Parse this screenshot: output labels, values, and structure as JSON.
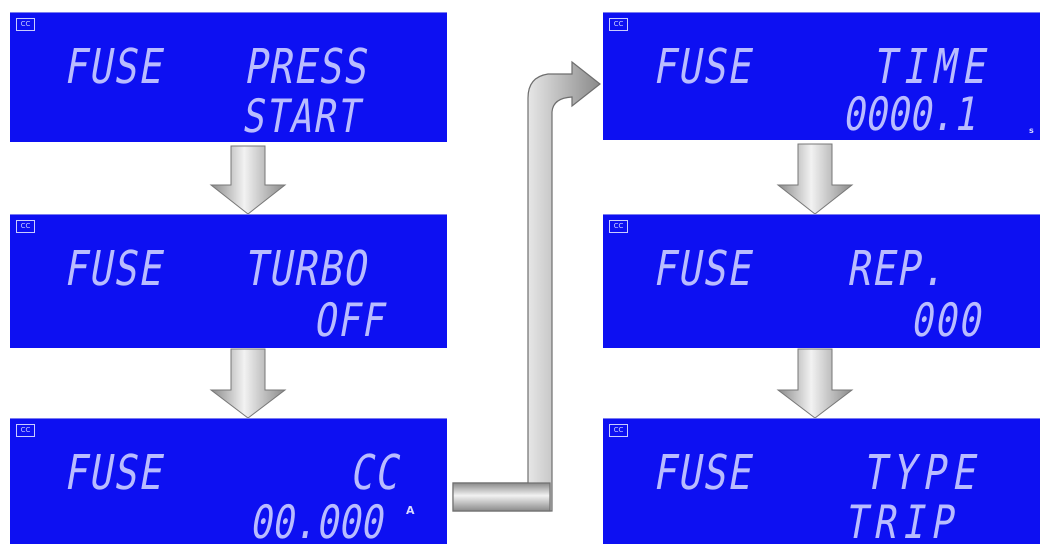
{
  "panels": [
    {
      "badge": "CC",
      "mode": "FUSE",
      "line1": "PRESS",
      "line2": "START",
      "unit": ""
    },
    {
      "badge": "CC",
      "mode": "FUSE",
      "line1": "TURBO",
      "line2": "OFF",
      "unit": ""
    },
    {
      "badge": "CC",
      "mode": "FUSE",
      "line1": "CC",
      "line2": "00.000",
      "unit": "A"
    },
    {
      "badge": "CC",
      "mode": "FUSE",
      "line1": "TIME",
      "line2": "0000.1",
      "unit": "s"
    },
    {
      "badge": "CC",
      "mode": "FUSE",
      "line1": "REP.",
      "line2": "000",
      "unit": ""
    },
    {
      "badge": "CC",
      "mode": "FUSE",
      "line1": "TYPE",
      "line2": "TRIP",
      "unit": ""
    }
  ],
  "colors": {
    "lcd_background": "#0d10f2",
    "lcd_segment": "#b9bcff",
    "arrow_fill": "#a6a6a6"
  }
}
